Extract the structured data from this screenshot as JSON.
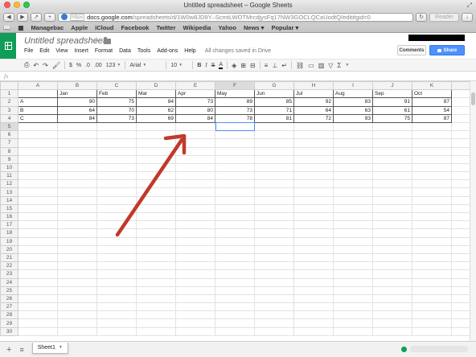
{
  "window": {
    "title": "Untitled spreadsheet – Google Sheets"
  },
  "browser": {
    "url_scheme": "https",
    "url_domain": "docs.google.com",
    "url_path": "/spreadsheets/d/1W0w8JD9Y–ScmtLWOTMrcdjysFq17NW3GOCLQCaUodtQ/edit#gid=0",
    "reader_label": "Reader",
    "bookmarks": [
      "Managebac",
      "Apple",
      "iCloud",
      "Facebook",
      "Twitter",
      "Wikipedia",
      "Yahoo",
      "News ▾",
      "Popular ▾"
    ]
  },
  "docs": {
    "title": "Untitled spreadsheet",
    "comments_label": "Comments",
    "share_label": "Share",
    "menu": [
      "File",
      "Edit",
      "View",
      "Insert",
      "Format",
      "Data",
      "Tools",
      "Add-ons",
      "Help"
    ],
    "save_status": "All changes saved in Drive"
  },
  "format_toolbar": {
    "currency": "$",
    "percent": "%",
    "decimal_dec": ".0",
    "decimal_inc": ".00",
    "more_formats": "123",
    "font": "Arial",
    "font_size": "10",
    "bold": "B",
    "italic": "I",
    "strike": "S",
    "text_color": "A"
  },
  "formula_bar": {
    "fx_label": "fx"
  },
  "sheet": {
    "columns": [
      "A",
      "B",
      "C",
      "D",
      "E",
      "F",
      "G",
      "H",
      "I",
      "J",
      "K"
    ],
    "selected_column": "F",
    "selected_row": 5,
    "header_row": [
      "",
      "Jan",
      "Feb",
      "Mar",
      "Apr",
      "May",
      "Jun",
      "Jul",
      "Aug",
      "Sep",
      "Oct"
    ],
    "data_rows": [
      [
        "A",
        "90",
        "75",
        "84",
        "73",
        "89",
        "85",
        "92",
        "83",
        "91",
        "87"
      ],
      [
        "B",
        "64",
        "70",
        "62",
        "80",
        "73",
        "71",
        "64",
        "63",
        "61",
        "54"
      ],
      [
        "C",
        "84",
        "73",
        "69",
        "84",
        "78",
        "81",
        "72",
        "93",
        "75",
        "87"
      ]
    ],
    "total_rows": 30
  },
  "bottom_bar": {
    "sheet_tab": "Sheet1"
  },
  "annotation": {
    "arrow_color": "#c0392b"
  }
}
